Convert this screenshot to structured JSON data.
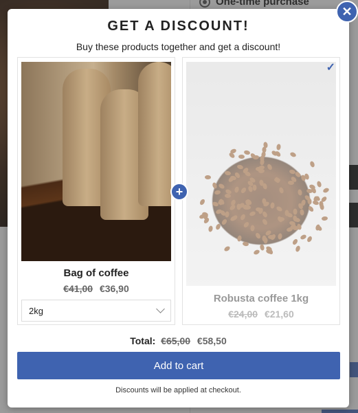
{
  "background": {
    "purchase_option": "One-time purchase"
  },
  "modal": {
    "close_icon": "✕",
    "title": "GET A DISCOUNT!",
    "subtitle": "Buy these products together and get a discount!",
    "plus_icon": "+",
    "products": [
      {
        "name": "Bag of coffee",
        "old_price": "€41,00",
        "new_price": "€36,90",
        "variant": "2kg",
        "image": "coffee-bags-photo"
      },
      {
        "name": "Robusta coffee 1kg",
        "old_price": "€24,00",
        "new_price": "€21,60",
        "image": "coffee-beans-photo",
        "checkmark": "✓"
      }
    ],
    "total_label": "Total:",
    "total_old": "€65,00",
    "total_new": "€58,50",
    "add_to_cart_label": "Add to cart",
    "footnote": "Discounts will be applied at checkout."
  },
  "colors": {
    "accent": "#3f63b0"
  }
}
